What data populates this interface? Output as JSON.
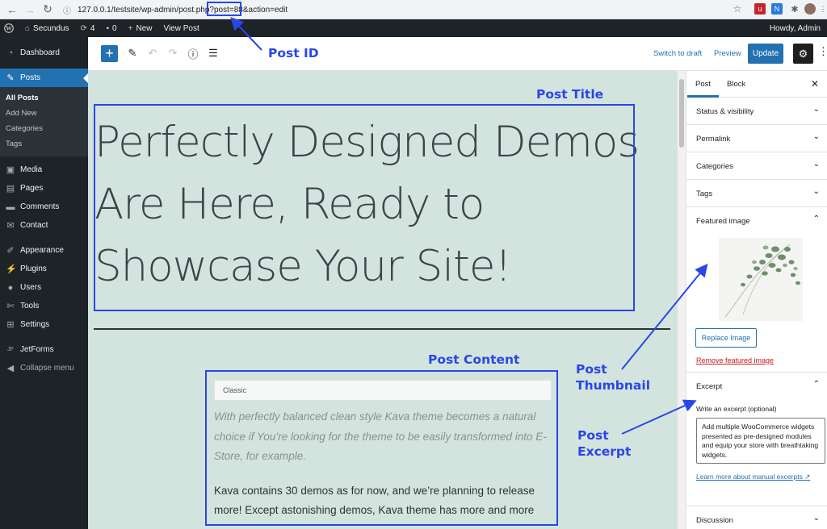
{
  "browser": {
    "url": "127.0.0.1/testsite/wp-admin/post.php?post=88&action=edit",
    "back_icon": "arrow-left",
    "forward_icon": "arrow-right",
    "reload_icon": "reload"
  },
  "admin_bar": {
    "site_name": "Secundus",
    "updates_count": "4",
    "comments_count": "0",
    "new_label": "New",
    "view_post_label": "View Post",
    "howdy": "Howdy, Admin"
  },
  "sidebar": {
    "items": [
      {
        "label": "Dashboard",
        "icon": "dashboard-icon"
      },
      {
        "label": "Posts",
        "icon": "pin-icon"
      },
      {
        "label": "Media",
        "icon": "media-icon"
      },
      {
        "label": "Pages",
        "icon": "pages-icon"
      },
      {
        "label": "Comments",
        "icon": "comments-icon"
      },
      {
        "label": "Contact",
        "icon": "contact-icon"
      },
      {
        "label": "Appearance",
        "icon": "appearance-icon"
      },
      {
        "label": "Plugins",
        "icon": "plugins-icon"
      },
      {
        "label": "Users",
        "icon": "users-icon"
      },
      {
        "label": "Tools",
        "icon": "tools-icon"
      },
      {
        "label": "Settings",
        "icon": "settings-icon"
      },
      {
        "label": "JetForms",
        "icon": "jetforms-icon"
      },
      {
        "label": "Collapse menu",
        "icon": "collapse-icon"
      }
    ],
    "posts_submenu": [
      "All Posts",
      "Add New",
      "Categories",
      "Tags"
    ]
  },
  "editor": {
    "switch_to_draft": "Switch to draft",
    "preview": "Preview",
    "update": "Update"
  },
  "post": {
    "title": "Perfectly Designed Demos Are Here, Ready to Showcase Your Site!",
    "classic_label": "Classic",
    "italic_paragraph": "With perfectly balanced clean style Kava theme becomes a natural choice if You’re looking for the theme to be easily transformed into E-Store, for example.",
    "body_paragraph": "Kava contains 30 demos as for now, and we’re planning to release more! Except astonishing demos, Kava theme has more and more"
  },
  "panel": {
    "tab_post": "Post",
    "tab_block": "Block",
    "sections": {
      "status": "Status & visibility",
      "permalink": "Permalink",
      "categories": "Categories",
      "tags": "Tags",
      "featured_image": "Featured image",
      "excerpt": "Excerpt",
      "discussion": "Discussion"
    },
    "replace_image": "Replace Image",
    "remove_featured": "Remove featured image",
    "excerpt_help": "Write an excerpt (optional)",
    "excerpt_value": "Add multiple WooCommerce widgets presented as pre-designed modules and equip your store with breathtaking widgets.",
    "learn_more": "Learn more about manual excerpts"
  },
  "annotations": {
    "post_id": "Post ID",
    "post_title": "Post Title",
    "post_content": "Post Content",
    "post_thumbnail_1": "Post",
    "post_thumbnail_2": "Thumbnail",
    "post_excerpt_1": "Post",
    "post_excerpt_2": "Excerpt"
  },
  "colors": {
    "accent": "#2271b1",
    "annotation": "#2946e8",
    "canvas": "#d3e4de",
    "admin_dark": "#1d2327"
  }
}
